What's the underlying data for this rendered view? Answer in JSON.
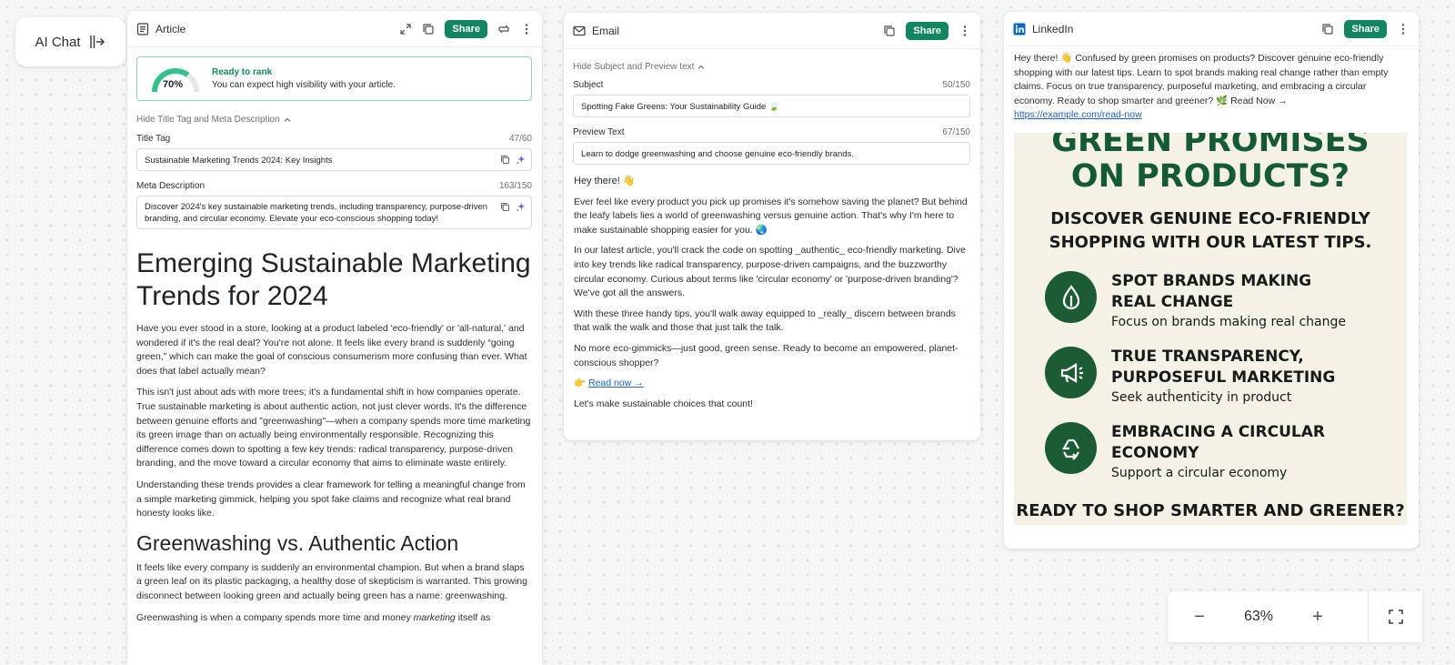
{
  "ai_chat": {
    "label": "AI Chat",
    "icon": "sidebar-collapse-icon"
  },
  "article": {
    "title": "Article",
    "share_label": "Share",
    "rank": {
      "percent": 70,
      "percent_label": "70%",
      "title": "Ready to rank",
      "message": "You can expect high visibility with your article."
    },
    "toggle_label": "Hide Title Tag and Meta Description",
    "title_tag": {
      "label": "Title Tag",
      "count": "47/60",
      "value": "Sustainable Marketing Trends 2024: Key Insights"
    },
    "meta_description": {
      "label": "Meta Description",
      "count": "163/150",
      "value": "Discover 2024's key sustainable marketing trends, including transparency, purpose-driven branding, and circular economy. Elevate your eco-conscious shopping today!"
    },
    "h1": "Emerging Sustainable Marketing Trends for 2024",
    "p1": "Have you ever stood in a store, looking at a product labeled 'eco-friendly' or 'all-natural,' and wondered if it's the real deal? You're not alone. It feels like every brand is suddenly “going green,” which can make the goal of conscious consumerism more confusing than ever. What does that label actually mean?",
    "p2": "This isn't just about ads with more trees; it's a fundamental shift in how companies operate. True sustainable marketing is about authentic action, not just clever words. It's the difference between genuine efforts and \"greenwashing\"—when a company spends more time marketing its green image than on actually being environmentally responsible. Recognizing this difference comes down to spotting a few key trends: radical transparency, purpose-driven branding, and the move toward a circular economy that aims to eliminate waste entirely.",
    "p3": "Understanding these trends provides a clear framework for telling a meaningful change from a simple marketing gimmick, helping you spot fake claims and recognize what real brand honesty looks like.",
    "h2": "Greenwashing vs. Authentic Action",
    "p4": "It feels like every company is suddenly an environmental champion. But when a brand slaps a green leaf on its plastic packaging, a healthy dose of skepticism is warranted. This growing disconnect between looking green and actually being green has a name: greenwashing.",
    "p5_start": "Greenwashing is when a company spends more time and money ",
    "p5_em": "marketing",
    "p5_end": " itself as"
  },
  "email": {
    "title": "Email",
    "share_label": "Share",
    "toggle_label": "Hide Subject and Preview text",
    "subject": {
      "label": "Subject",
      "count": "50/150",
      "value": "Spotting Fake Greens: Your Sustainability Guide 🍃"
    },
    "preview": {
      "label": "Preview Text",
      "count": "67/150",
      "value": "Learn to dodge greenwashing and choose genuine eco-friendly brands."
    },
    "greeting": "Hey there! 👋",
    "p1": "Ever feel like every product you pick up promises it's somehow saving the planet? But behind the leafy labels lies a world of greenwashing versus genuine action. That's why I'm here to make sustainable shopping easier for you. 🌏",
    "p2": "In our latest article, you'll crack the code on spotting _authentic_ eco-friendly marketing. Dive into key trends like radical transparency, purpose-driven campaigns, and the buzzworthy circular economy. Curious about terms like 'circular economy' or 'purpose-driven branding'? We've got all the answers.",
    "p3": "With these three handy tips, you'll walk away equipped to _really_ discern between brands that walk the walk and those that just talk the talk.",
    "p4": "No more eco-gimmicks—just good, green sense. Ready to become an empowered, planet-conscious shopper?",
    "cta_emoji": "👉",
    "cta_link": "Read now →",
    "closing": "Let's make sustainable choices that count!"
  },
  "linkedin": {
    "title": "LinkedIn",
    "share_label": "Share",
    "post_text": "Hey there! 👋 Confused by green promises on products? Discover genuine eco-friendly shopping with our latest tips. Learn to spot brands making real change rather than empty claims. Focus on true transparency, purposeful marketing, and embracing a circular economy. Ready to shop smarter and greener? 🌿 Read Now →",
    "link": "https://example.com/read-now",
    "image": {
      "headline_1": "GREEN PROMISES",
      "headline_2": "ON PRODUCTS?",
      "sub_1": "DISCOVER GENUINE ECO-FRIENDLY",
      "sub_2": "SHOPPING WITH OUR LATEST TIPS.",
      "items": [
        {
          "icon": "leaf-drop-icon",
          "title_1": "SPOT BRANDS MAKING",
          "title_2": "REAL CHANGE",
          "sub": "Focus on brands making real change"
        },
        {
          "icon": "megaphone-icon",
          "title_1": "TRUE TRANSPARENCY,",
          "title_2": "PURPOSEFUL MARKETING",
          "sub": "Seek autĥenticity in product"
        },
        {
          "icon": "recycle-icon",
          "title_1": "EMBRACING A CIRCULAR",
          "title_2": "ECONOMY",
          "sub": "Support a circular economy"
        }
      ],
      "footer": "READY TO SHOP SMARTER AND GREENER?"
    }
  },
  "zoom": {
    "minus": "−",
    "value": "63%",
    "plus": "+"
  },
  "colors": {
    "brand_green": "#12875f",
    "image_green": "#1c5c34",
    "link_blue": "#1f5fbf"
  }
}
